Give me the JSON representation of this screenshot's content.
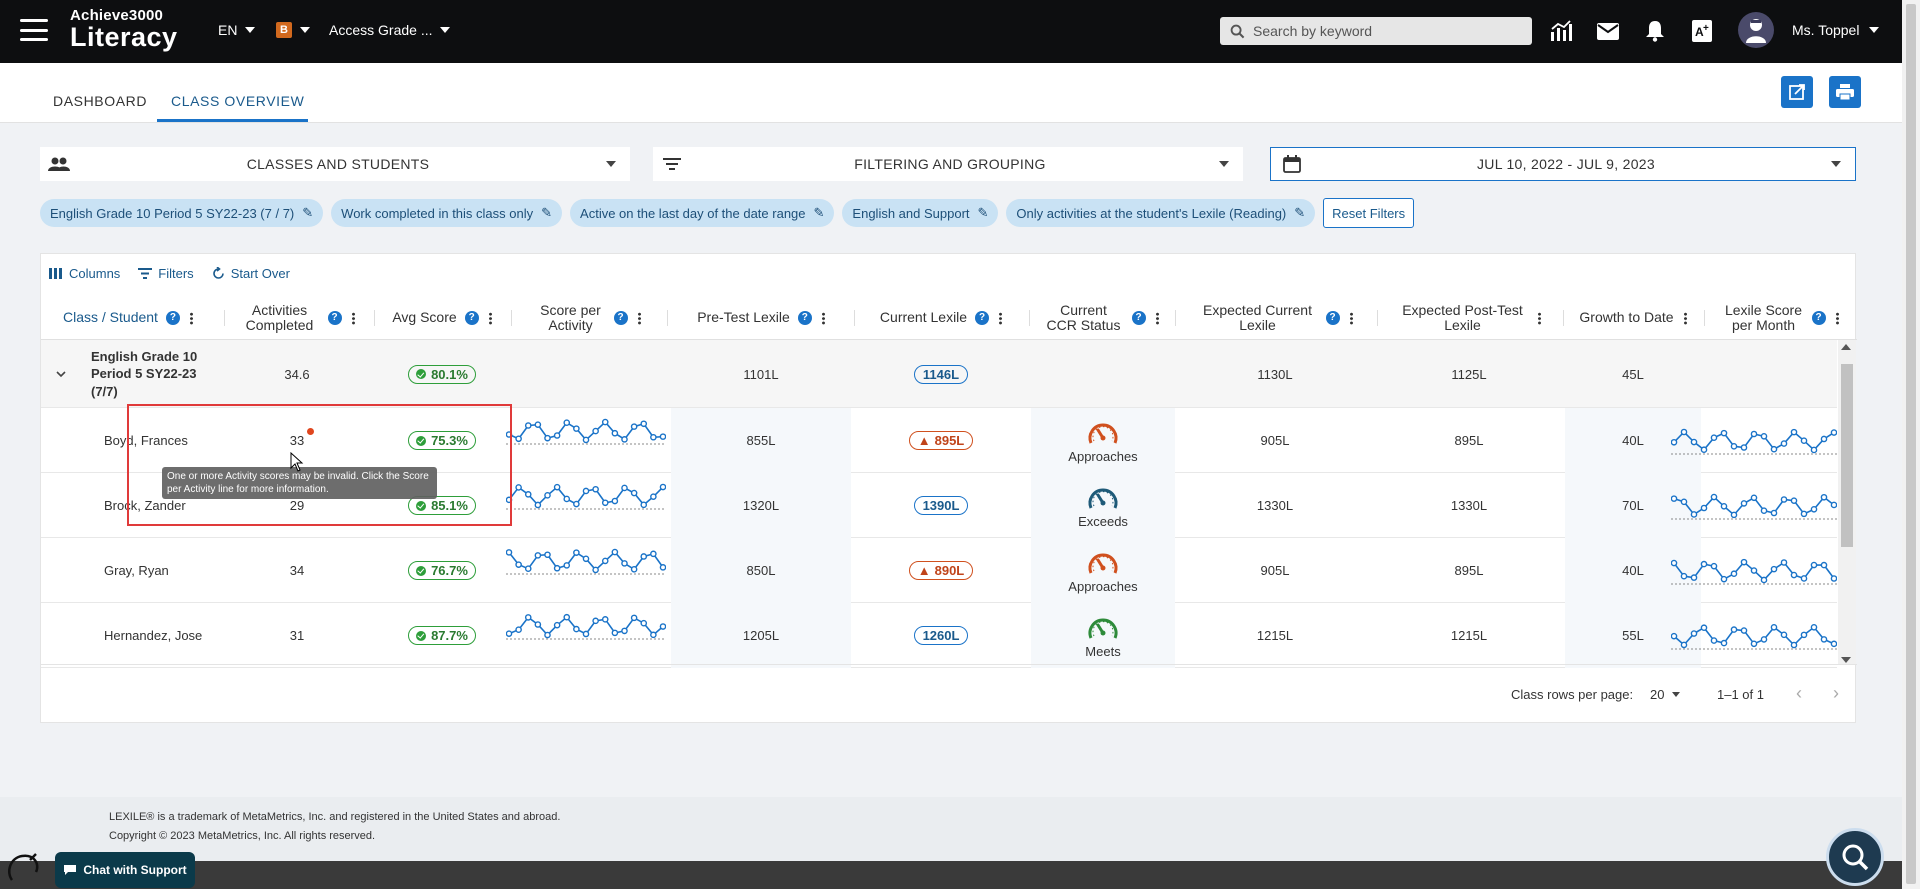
{
  "header": {
    "logo_top": "Achieve3000",
    "logo_bottom": "Literacy",
    "language": "EN",
    "level_badge": "B",
    "program": "Access Grade ...",
    "search_placeholder": "Search by keyword",
    "user_name": "Ms. Toppel"
  },
  "tabs": [
    {
      "label": "DASHBOARD"
    },
    {
      "label": "CLASS OVERVIEW"
    }
  ],
  "selectors": {
    "classes": "CLASSES AND STUDENTS",
    "filtering": "FILTERING AND GROUPING",
    "date_range": "JUL 10, 2022 - JUL 9, 2023"
  },
  "chips": [
    "English Grade 10 Period 5 SY22-23 (7 / 7)",
    "Work completed in this class only",
    "Active on the last day of the date range",
    "English and Support",
    "Only activities at the student's Lexile (Reading)"
  ],
  "reset_label": "Reset Filters",
  "toolbar": {
    "columns": "Columns",
    "filters": "Filters",
    "start_over": "Start Over"
  },
  "columns": [
    "Class / Student",
    "Activities Completed",
    "Avg Score",
    "Score per Activity",
    "Pre-Test Lexile",
    "Current Lexile",
    "Current CCR Status",
    "Expected Current Lexile",
    "Expected Post-Test Lexile",
    "Growth to Date",
    "Lexile Score per Month"
  ],
  "class_row": {
    "name": "English Grade 10 Period 5 SY22-23 (7/7)",
    "activities": "34.6",
    "avg_score": "80.1%",
    "pre_test": "1101L",
    "current": "1146L",
    "expected_current": "1130L",
    "expected_post": "1125L",
    "growth": "45L"
  },
  "students": [
    {
      "name": "Boyd, Frances",
      "activities": "33",
      "avg_score": "75.3%",
      "pre_test": "855L",
      "current": "895L",
      "current_warn": true,
      "ccr": "Approaches",
      "expected_current": "905L",
      "expected_post": "895L",
      "growth": "40L"
    },
    {
      "name": "Brock, Zander",
      "activities": "29",
      "avg_score": "85.1%",
      "pre_test": "1320L",
      "current": "1390L",
      "current_warn": false,
      "ccr": "Exceeds",
      "expected_current": "1330L",
      "expected_post": "1330L",
      "growth": "70L"
    },
    {
      "name": "Gray, Ryan",
      "activities": "34",
      "avg_score": "76.7%",
      "pre_test": "850L",
      "current": "890L",
      "current_warn": true,
      "ccr": "Approaches",
      "expected_current": "905L",
      "expected_post": "895L",
      "growth": "40L"
    },
    {
      "name": "Hernandez, Jose",
      "activities": "31",
      "avg_score": "87.7%",
      "pre_test": "1205L",
      "current": "1260L",
      "current_warn": false,
      "ccr": "Meets",
      "expected_current": "1215L",
      "expected_post": "1215L",
      "growth": "55L"
    }
  ],
  "tooltip": "One or more Activity scores may be invalid. Click the Score per Activity line for more information.",
  "pagination": {
    "rows_label": "Class rows per page:",
    "rows_value": "20",
    "range": "1–1 of 1"
  },
  "footer": {
    "line1": "LEXILE® is a trademark of MetaMetrics, Inc. and registered in the United States and abroad.",
    "line2": "Copyright © 2023 MetaMetrics, Inc. All rights reserved."
  },
  "chat_label": "Chat with Support",
  "colors": {
    "accent": "#1a73c8",
    "approaches": "#d0501e",
    "exceeds": "#1e5a78",
    "meets": "#2e8b3a"
  }
}
